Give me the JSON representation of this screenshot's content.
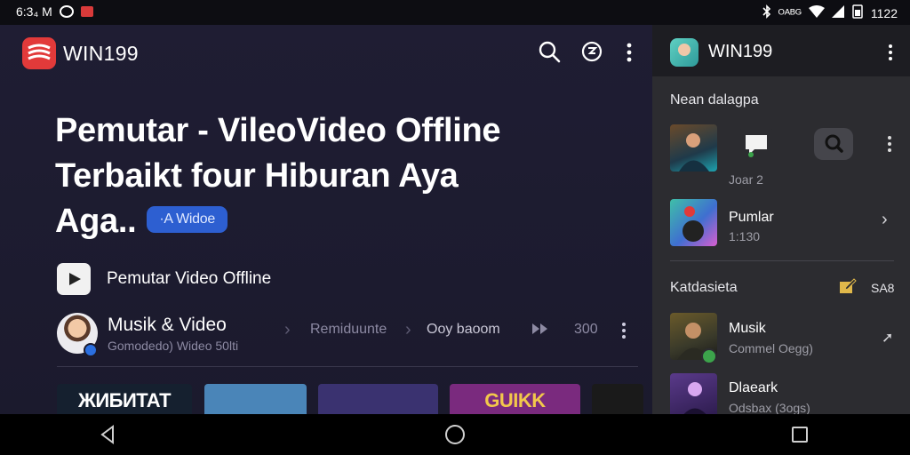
{
  "status_bar": {
    "time": "6:3₄ M",
    "right_text": "ᴼᴬᴮᴳ",
    "battery_text": "1122"
  },
  "app_bar": {
    "title": "WIN199",
    "icons": [
      "search-icon",
      "sync-icon",
      "more-vert-icon"
    ],
    "logo_color": "#e23a3a"
  },
  "hero": {
    "line1": "Pemutar - VileoVideo Offline",
    "line2": "Terbaikt four Hiburan Aya",
    "line3": "Aga..",
    "chip_label": "·A Widoe",
    "chip_color": "#2d5fd1"
  },
  "offline_row": {
    "label": "Pemutar Video Offline"
  },
  "musik_row": {
    "title": "Musik & Video",
    "subtitle": "Gomodedo) Wideo 50lti",
    "crumb1": "Remiduunte",
    "crumb2": "Ooy baoom",
    "count": "300"
  },
  "thumbnails": [
    {
      "text": "ЖИБИТАТ",
      "bg": "#15202f",
      "color": "#ffffff"
    },
    {
      "text": "",
      "bg": "#4a85b8",
      "color": "#ffffff"
    },
    {
      "text": "",
      "bg": "#3a3270",
      "color": "#ffffff"
    },
    {
      "text": "GUIKK",
      "bg": "#7a2a7e",
      "color": "#f2c84b"
    },
    {
      "text": "",
      "bg": "#1a1a1a",
      "color": "#ffffff"
    }
  ],
  "side": {
    "title": "WIN199",
    "section1_title": "Nean dalagpa",
    "item1_sub": "Joar 2",
    "item2_title": "Pumlar",
    "item2_sub": "1:130",
    "section2_title": "Katdasieta",
    "section2_count": "SA8",
    "item3_title": "Musik",
    "item3_sub": "Commel Oegg)",
    "item4_title": "Dlaeark",
    "item4_sub": "Odsbax (3ogs)"
  },
  "colors": {
    "main_bg": "#1f1d33",
    "side_bg": "#2c2c30",
    "accent_blue": "#2d5fd1",
    "accent_red": "#e23a3a",
    "accent_green": "#3ca34b"
  }
}
